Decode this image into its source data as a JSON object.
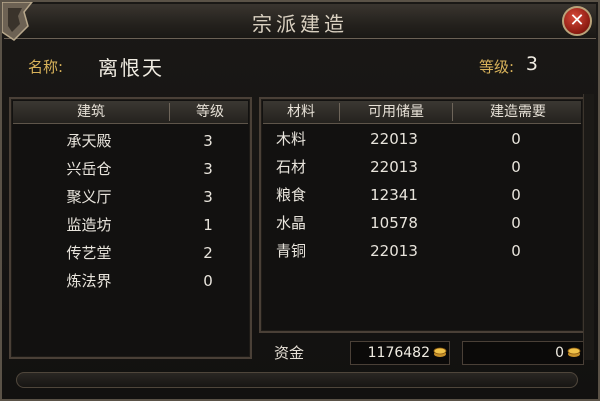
{
  "window": {
    "title": "宗派建造"
  },
  "info": {
    "name_label": "名称:",
    "name_value": "离恨天",
    "level_label": "等级:",
    "level_value": "3"
  },
  "buildings": {
    "headers": {
      "name": "建筑",
      "level": "等级"
    },
    "rows": [
      {
        "name": "承天殿",
        "level": "3"
      },
      {
        "name": "兴岳仓",
        "level": "3"
      },
      {
        "name": "聚义厅",
        "level": "3"
      },
      {
        "name": "监造坊",
        "level": "1"
      },
      {
        "name": "传艺堂",
        "level": "2"
      },
      {
        "name": "炼法界",
        "level": "0"
      }
    ]
  },
  "materials": {
    "headers": {
      "name": "材料",
      "available": "可用储量",
      "required": "建造需要"
    },
    "rows": [
      {
        "name": "木料",
        "available": "22013",
        "required": "0"
      },
      {
        "name": "石材",
        "available": "22013",
        "required": "0"
      },
      {
        "name": "粮食",
        "available": "12341",
        "required": "0"
      },
      {
        "name": "水晶",
        "available": "10578",
        "required": "0"
      },
      {
        "name": "青铜",
        "available": "22013",
        "required": "0"
      }
    ]
  },
  "funds": {
    "label": "资金",
    "available": "1176482",
    "required": "0"
  },
  "icons": {
    "close": "close-icon",
    "coin": "gold-coin-icon",
    "ornament": "corner-ornament-icon"
  },
  "colors": {
    "gold": "#d8b25a",
    "close_red": "#c0301f",
    "text": "#e8e4dc"
  }
}
